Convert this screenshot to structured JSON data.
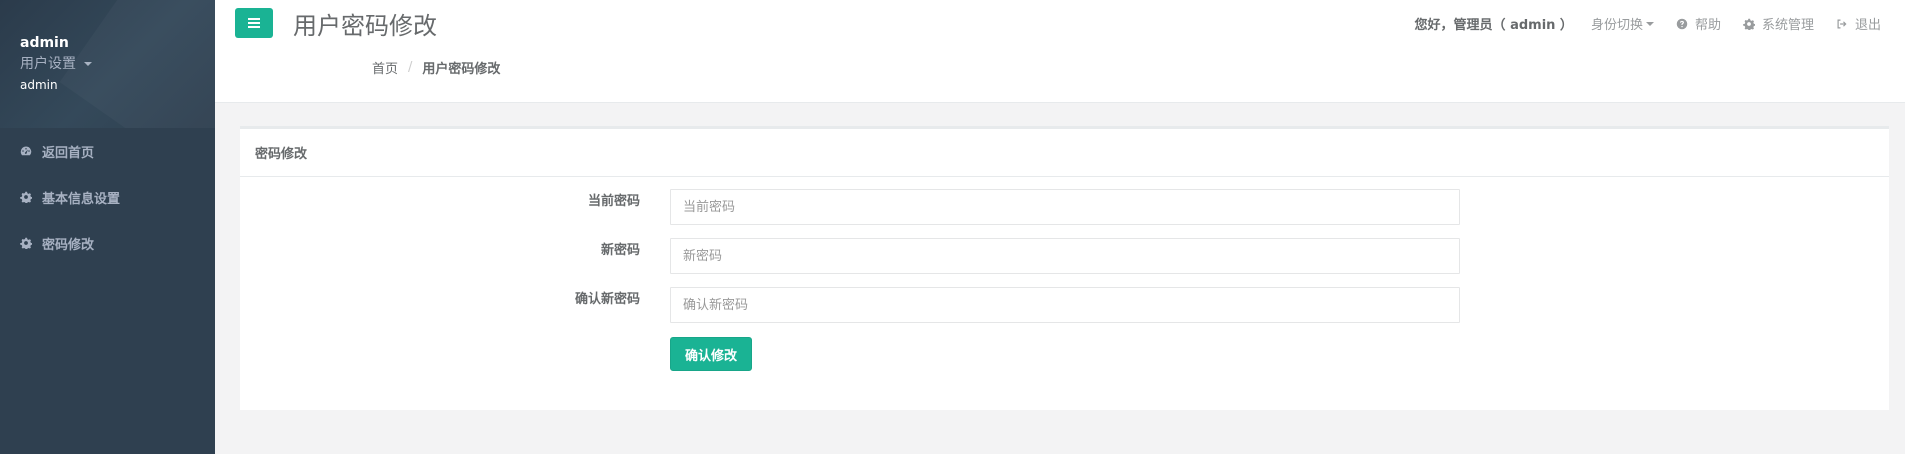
{
  "sidebar": {
    "profile": {
      "name": "admin",
      "role_menu": "用户设置",
      "sub": "admin"
    },
    "items": [
      {
        "label": "返回首页",
        "icon": "dashboard-icon"
      },
      {
        "label": "基本信息设置",
        "icon": "gear-icon"
      },
      {
        "label": "密码修改",
        "icon": "gear-icon"
      }
    ]
  },
  "header": {
    "title": "用户密码修改",
    "breadcrumb": [
      "首页",
      "用户密码修改"
    ],
    "breadcrumb_sep": "/",
    "greeting": "您好，管理员（ admin ）",
    "links": [
      {
        "label": "身份切换",
        "icon": "",
        "dropdown": true
      },
      {
        "label": "帮助",
        "icon": "question-circle-icon"
      },
      {
        "label": "系统管理",
        "icon": "gear-icon"
      },
      {
        "label": "退出",
        "icon": "sign-out-icon"
      }
    ]
  },
  "form": {
    "heading": "密码修改",
    "fields": [
      {
        "label": "当前密码",
        "value": "",
        "placeholder": "当前密码"
      },
      {
        "label": "新密码",
        "value": "",
        "placeholder": "新密码"
      },
      {
        "label": "确认新密码",
        "value": "",
        "placeholder": "确认新密码"
      }
    ],
    "submit_label": "确认修改"
  },
  "colors": {
    "accent": "#1ab394",
    "sidebar_bg": "#2f4050",
    "sidebar_text": "#a7b1c2",
    "page_bg": "#f3f3f4"
  }
}
